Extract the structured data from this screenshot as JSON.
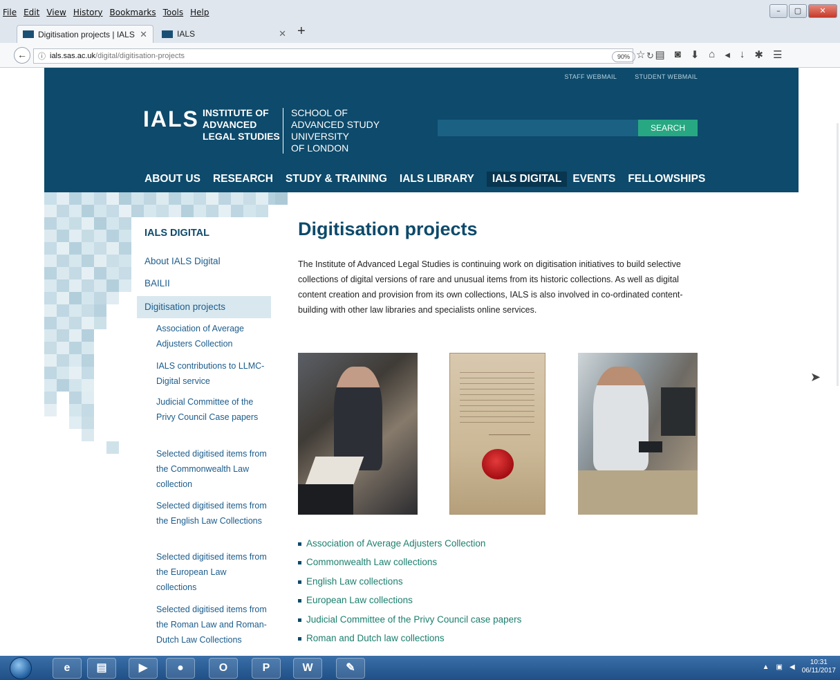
{
  "browser": {
    "menus": [
      "File",
      "Edit",
      "View",
      "History",
      "Bookmarks",
      "Tools",
      "Help"
    ],
    "tabs": [
      {
        "title": "Digitisation projects | IALS"
      },
      {
        "title": "IALS"
      }
    ],
    "url_host": "ials.sas.ac.uk",
    "url_path": "/digital/digitisation-projects",
    "zoom": "90%"
  },
  "header": {
    "top_links": [
      "STAFF WEBMAIL",
      "STUDENT WEBMAIL"
    ],
    "logo_short": "IALS",
    "logo_lines": [
      "INSTITUTE OF",
      "ADVANCED",
      "LEGAL STUDIES"
    ],
    "school_lines": [
      "SCHOOL OF",
      "ADVANCED STUDY",
      "UNIVERSITY",
      "OF LONDON"
    ],
    "search_label": "SEARCH",
    "nav": [
      "ABOUT US",
      "RESEARCH",
      "STUDY & TRAINING",
      "IALS LIBRARY",
      "IALS DIGITAL",
      "EVENTS",
      "FELLOWSHIPS"
    ]
  },
  "sidebar": {
    "title": "IALS DIGITAL",
    "items": [
      "About IALS Digital",
      "BAILII",
      "Digitisation projects"
    ],
    "subitems": [
      "Association of Average Adjusters Collection",
      "IALS contributions to LLMC-Digital service",
      "Judicial Committee of the Privy Council Case papers",
      "Selected digitised items from the Commonwealth Law collection",
      "Selected digitised items from the English Law Collections",
      "Selected digitised items from the European Law collections",
      "Selected digitised items from the Roman Law and Roman-Dutch Law Collections"
    ]
  },
  "main": {
    "title": "Digitisation projects",
    "intro": "The Institute of Advanced Legal Studies is continuing work on digitisation initiatives to build selective collections of digital versions of rare and unusual items from its historic collections. As well as digital content creation and provision from its own collections, IALS is also involved in co-ordinated content-building with other law libraries and specialists online services.",
    "links": [
      "Association of Average Adjusters Collection",
      "Commonwealth Law collections",
      "English Law collections",
      "European Law collections",
      "Judicial Committee of the Privy Council case papers",
      "Roman and Dutch law collections"
    ]
  },
  "taskbar": {
    "apps": [
      "e",
      "",
      "",
      "",
      "O",
      "P",
      "W",
      ""
    ],
    "time": "10:31",
    "date": "06/11/2017"
  },
  "colors": {
    "header_bg": "#0d4a6b",
    "search_btn": "#28a882",
    "link": "#1b7f6e"
  }
}
